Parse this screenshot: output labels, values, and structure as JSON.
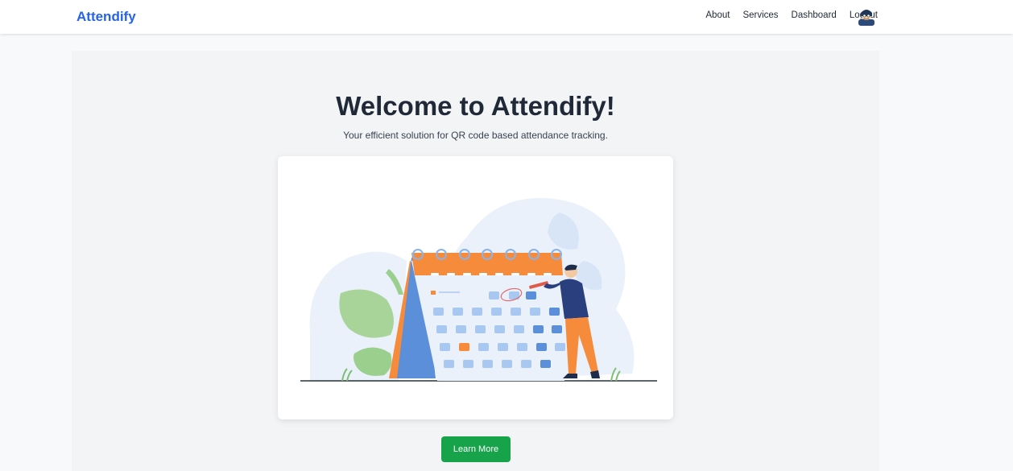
{
  "navbar": {
    "brand": "Attendify",
    "links": [
      "About",
      "Services",
      "Dashboard",
      "Logout"
    ],
    "avatar_icon": "user-avatar-icon"
  },
  "hero": {
    "title": "Welcome to Attendify!",
    "subtitle": "Your efficient solution for QR code based attendance tracking.",
    "illustration": "calendar-illustration",
    "button_label": "Learn More"
  },
  "colors": {
    "brand": "#2563eb",
    "button": "#16a34a",
    "calendar_header": "#f68b3c",
    "calendar_side": "#5b8fd9",
    "person_shirt": "#2a3f7e",
    "person_pants": "#f68b3c"
  }
}
